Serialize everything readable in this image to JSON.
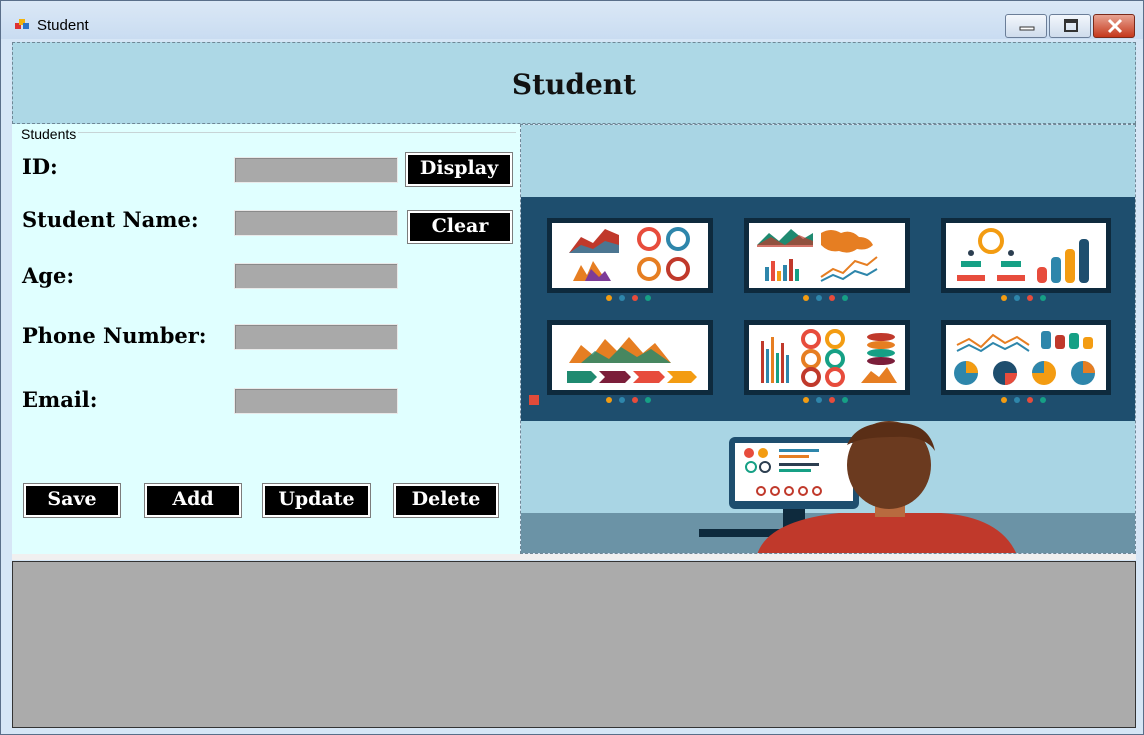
{
  "window": {
    "title": "Student"
  },
  "header": {
    "title": "Student"
  },
  "form": {
    "group_title": "Students",
    "labels": {
      "id": "ID:",
      "name": "Student Name:",
      "age": "Age:",
      "phone": "Phone Number:",
      "email": "Email:"
    },
    "values": {
      "id": "",
      "name": "",
      "age": "",
      "phone": "",
      "email": ""
    },
    "buttons": {
      "display": "Display",
      "clear": "Clear",
      "save": "Save",
      "add": "Add",
      "update": "Update",
      "delete": "Delete"
    }
  },
  "colors": {
    "header_bg": "#add8e6",
    "form_bg": "#e0ffff",
    "input_bg": "#a9a9a9",
    "button_bg": "#000000",
    "grid_bg": "#ababab"
  }
}
